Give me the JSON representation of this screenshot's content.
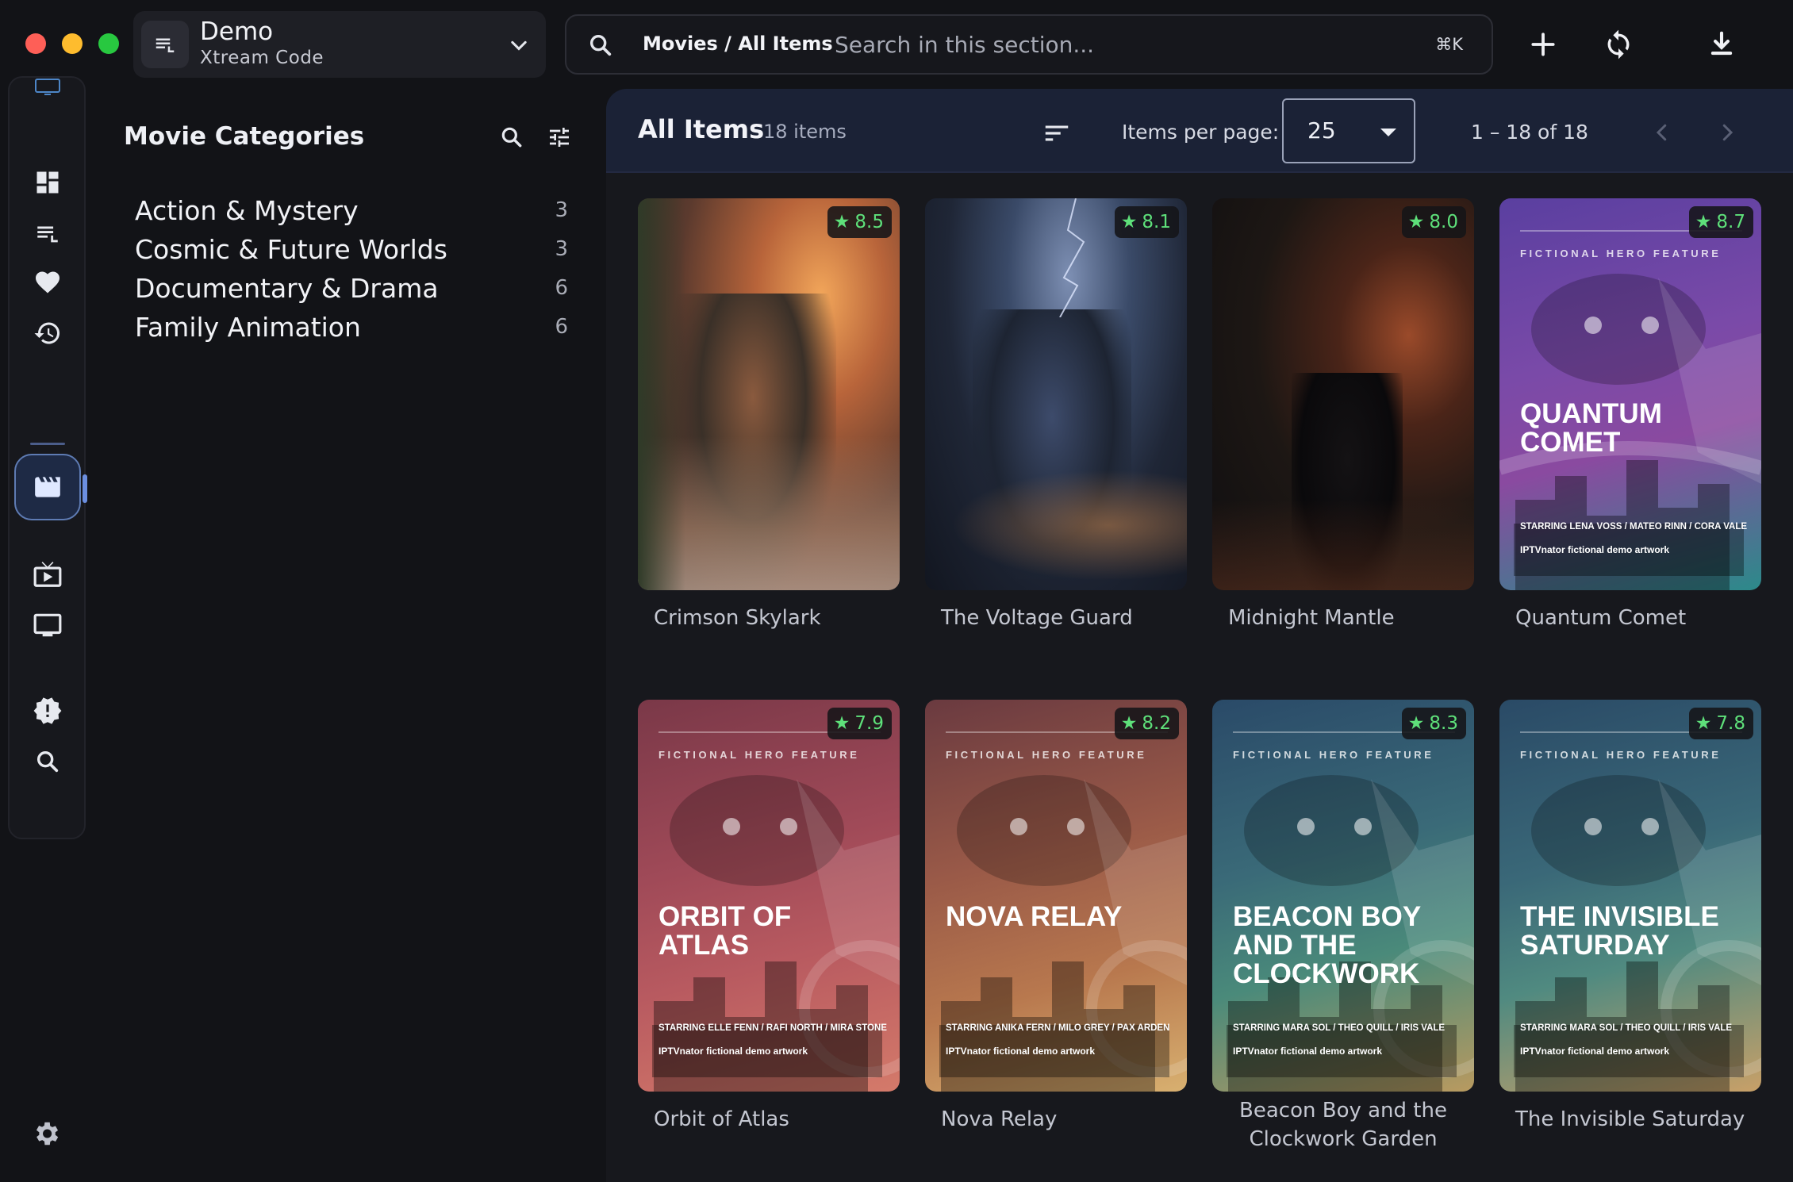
{
  "window": {
    "playlist": {
      "name": "Demo",
      "type": "Xtream Code"
    }
  },
  "search": {
    "breadcrumb": "Movies / All Items",
    "placeholder": "Search in this section...",
    "shortcut": "⌘K"
  },
  "rail": {
    "items": [
      {
        "name": "dashboard-icon"
      },
      {
        "name": "playlist-icon"
      },
      {
        "name": "favorites-heart-icon"
      },
      {
        "name": "history-icon"
      },
      {
        "name": "movies-icon",
        "active": true
      },
      {
        "name": "series-icon"
      },
      {
        "name": "live-tv-icon"
      },
      {
        "name": "alert-badge-icon"
      },
      {
        "name": "search-icon"
      }
    ]
  },
  "categories": {
    "title": "Movie Categories",
    "items": [
      {
        "label": "Action & Mystery",
        "count": "3"
      },
      {
        "label": "Cosmic & Future Worlds",
        "count": "3"
      },
      {
        "label": "Documentary & Drama",
        "count": "6"
      },
      {
        "label": "Family Animation",
        "count": "6"
      }
    ]
  },
  "main": {
    "title": "All Items",
    "count": "18 items",
    "per_page_label": "Items per page:",
    "per_page_value": "25",
    "range": "1 – 18 of 18"
  },
  "cards": [
    {
      "title": "Crimson Skylark",
      "rating": "8.5",
      "poster": "photo"
    },
    {
      "title": "The Voltage Guard",
      "rating": "8.1",
      "poster": "photo"
    },
    {
      "title": "Midnight Mantle",
      "rating": "8.0",
      "poster": "photo"
    },
    {
      "title": "Quantum Comet",
      "rating": "8.7",
      "poster": "generated",
      "feature": "FICTIONAL HERO FEATURE",
      "poster_title": "QUANTUM COMET",
      "stars": "STARRING LENA VOSS / MATEO RINN / CORA VALE",
      "credit": "IPTVnator fictional demo artwork"
    },
    {
      "title": "Orbit of Atlas",
      "rating": "7.9",
      "poster": "generated",
      "feature": "FICTIONAL HERO FEATURE",
      "poster_title": "ORBIT OF\nATLAS",
      "stars": "STARRING ELLE FENN / RAFI NORTH / MIRA STONE",
      "credit": "IPTVnator fictional demo artwork"
    },
    {
      "title": "Nova Relay",
      "rating": "8.2",
      "poster": "generated",
      "feature": "FICTIONAL HERO FEATURE",
      "poster_title": "NOVA RELAY",
      "stars": "STARRING ANIKA FERN / MILO GREY / PAX ARDEN",
      "credit": "IPTVnator fictional demo artwork"
    },
    {
      "title": "Beacon Boy and the Clockwork Garden",
      "rating": "8.3",
      "poster": "generated",
      "feature": "FICTIONAL HERO FEATURE",
      "poster_title": "BEACON BOY\nAND THE\nCLOCKWORK",
      "stars": "STARRING MARA SOL / THEO QUILL / IRIS VALE",
      "credit": "IPTVnator fictional demo artwork"
    },
    {
      "title": "The Invisible Saturday",
      "rating": "7.8",
      "poster": "generated",
      "feature": "FICTIONAL HERO FEATURE",
      "poster_title": "THE INVISIBLE\nSATURDAY",
      "stars": "STARRING MARA SOL / THEO QUILL / IRIS VALE",
      "credit": "IPTVnator fictional demo artwork"
    }
  ],
  "colors": {
    "accent": "#6c8fe0",
    "rating": "#5ee07a",
    "background": "#121317",
    "header": "#1b2236"
  }
}
